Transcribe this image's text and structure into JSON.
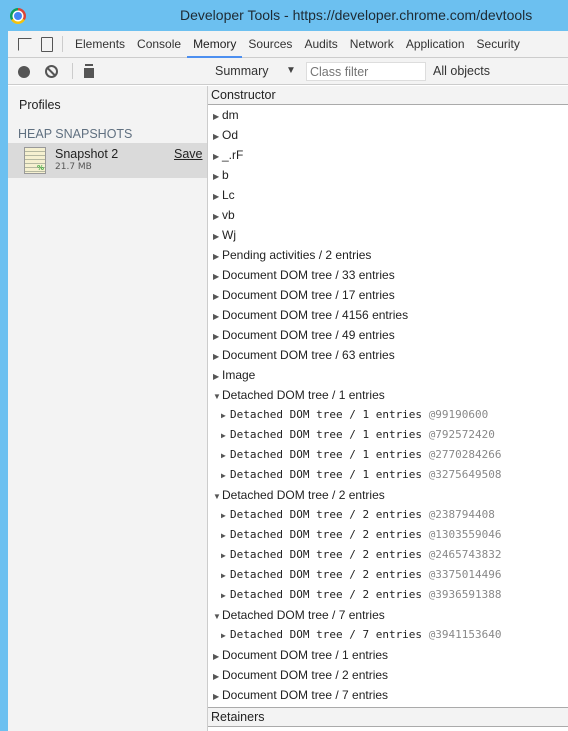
{
  "window": {
    "title": "Developer Tools - https://developer.chrome.com/devtools"
  },
  "tabs": [
    {
      "label": "Elements"
    },
    {
      "label": "Console"
    },
    {
      "label": "Memory",
      "active": true
    },
    {
      "label": "Sources"
    },
    {
      "label": "Audits"
    },
    {
      "label": "Network"
    },
    {
      "label": "Application"
    },
    {
      "label": "Security"
    }
  ],
  "toolbar": {
    "view_select": "Summary",
    "class_filter_placeholder": "Class filter",
    "objects_filter": "All objects"
  },
  "sidebar": {
    "profiles_label": "Profiles",
    "section_label": "HEAP SNAPSHOTS",
    "snapshot": {
      "name": "Snapshot 2",
      "size": "21.7 MB",
      "save_label": "Save"
    }
  },
  "table": {
    "column": "Constructor",
    "retainers_label": "Retainers",
    "rows": [
      {
        "level": 0,
        "expanded": false,
        "text": "dm"
      },
      {
        "level": 0,
        "expanded": false,
        "text": "Od"
      },
      {
        "level": 0,
        "expanded": false,
        "text": "_.rF"
      },
      {
        "level": 0,
        "expanded": false,
        "text": "b"
      },
      {
        "level": 0,
        "expanded": false,
        "text": "Lc"
      },
      {
        "level": 0,
        "expanded": false,
        "text": "vb"
      },
      {
        "level": 0,
        "expanded": false,
        "text": "Wj"
      },
      {
        "level": 0,
        "expanded": false,
        "text": "Pending activities / 2 entries"
      },
      {
        "level": 0,
        "expanded": false,
        "text": "Document DOM tree / 33 entries"
      },
      {
        "level": 0,
        "expanded": false,
        "text": "Document DOM tree / 17 entries"
      },
      {
        "level": 0,
        "expanded": false,
        "text": "Document DOM tree / 4156 entries"
      },
      {
        "level": 0,
        "expanded": false,
        "text": "Document DOM tree / 49 entries"
      },
      {
        "level": 0,
        "expanded": false,
        "text": "Document DOM tree / 63 entries"
      },
      {
        "level": 0,
        "expanded": false,
        "text": "Image"
      },
      {
        "level": 0,
        "expanded": true,
        "text": "Detached DOM tree / 1 entries"
      },
      {
        "level": 1,
        "expanded": false,
        "text": "Detached DOM tree / 1 entries",
        "id": "@99190600"
      },
      {
        "level": 1,
        "expanded": false,
        "text": "Detached DOM tree / 1 entries",
        "id": "@792572420"
      },
      {
        "level": 1,
        "expanded": false,
        "text": "Detached DOM tree / 1 entries",
        "id": "@2770284266"
      },
      {
        "level": 1,
        "expanded": false,
        "text": "Detached DOM tree / 1 entries",
        "id": "@3275649508"
      },
      {
        "level": 0,
        "expanded": true,
        "text": "Detached DOM tree / 2 entries"
      },
      {
        "level": 1,
        "expanded": false,
        "text": "Detached DOM tree / 2 entries",
        "id": "@238794408"
      },
      {
        "level": 1,
        "expanded": false,
        "text": "Detached DOM tree / 2 entries",
        "id": "@1303559046"
      },
      {
        "level": 1,
        "expanded": false,
        "text": "Detached DOM tree / 2 entries",
        "id": "@2465743832"
      },
      {
        "level": 1,
        "expanded": false,
        "text": "Detached DOM tree / 2 entries",
        "id": "@3375014496"
      },
      {
        "level": 1,
        "expanded": false,
        "text": "Detached DOM tree / 2 entries",
        "id": "@3936591388"
      },
      {
        "level": 0,
        "expanded": true,
        "text": "Detached DOM tree / 7 entries"
      },
      {
        "level": 1,
        "expanded": false,
        "text": "Detached DOM tree / 7 entries",
        "id": "@3941153640"
      },
      {
        "level": 0,
        "expanded": false,
        "text": "Document DOM tree / 1 entries"
      },
      {
        "level": 0,
        "expanded": false,
        "text": "Document DOM tree / 2 entries"
      },
      {
        "level": 0,
        "expanded": false,
        "text": "Document DOM tree / 7 entries"
      }
    ]
  },
  "colors": {
    "window_border": "#6cc0f0",
    "active_tab": "#4c8ff0",
    "panel_bg": "#f3f3f3",
    "selected_item": "#dadada"
  }
}
